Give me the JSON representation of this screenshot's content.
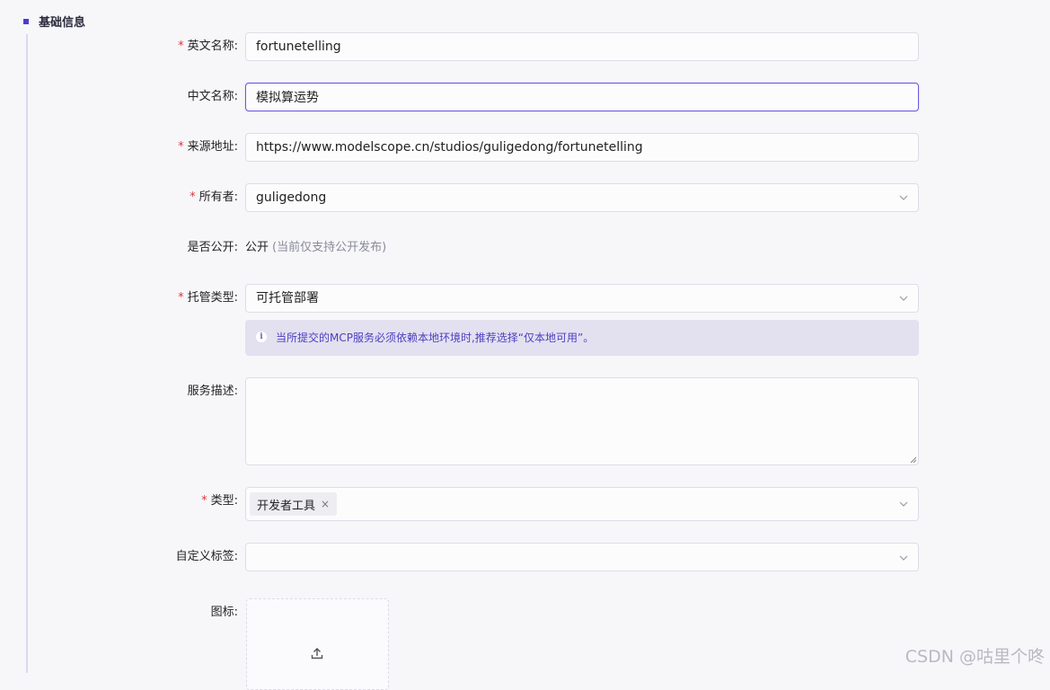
{
  "section": {
    "title": "基础信息"
  },
  "form": {
    "english_name": {
      "label": "英文名称:",
      "value": "fortunetelling",
      "required": true
    },
    "chinese_name": {
      "label": "中文名称:",
      "value": "模拟算运势",
      "required": false
    },
    "source_url": {
      "label": "来源地址:",
      "value": "https://www.modelscope.cn/studios/guligedong/fortunetelling",
      "required": true
    },
    "owner": {
      "label": "所有者:",
      "value": "guligedong",
      "required": true
    },
    "public": {
      "label": "是否公开:",
      "value": "公开",
      "hint": "(当前仅支持公开发布)"
    },
    "hosting_type": {
      "label": "托管类型:",
      "value": "可托管部署",
      "required": true,
      "notice": "当所提交的MCP服务必须依赖本地环境时,推荐选择“仅本地可用”。"
    },
    "description": {
      "label": "服务描述:",
      "value": ""
    },
    "category": {
      "label": "类型:",
      "tags": [
        "开发者工具"
      ],
      "required": true
    },
    "custom_tags": {
      "label": "自定义标签:",
      "value": ""
    },
    "icon": {
      "label": "图标:"
    }
  },
  "watermark": "CSDN @咕里个咚",
  "icons": {
    "chevron": "chevron-down-icon",
    "info": "info-icon",
    "upload": "upload-icon",
    "tag_close": "close-icon"
  },
  "colors": {
    "accent": "#4b3bd4",
    "required": "#e0363a",
    "notice_bg": "#e3e0f0",
    "notice_text": "#4c3fc0"
  }
}
